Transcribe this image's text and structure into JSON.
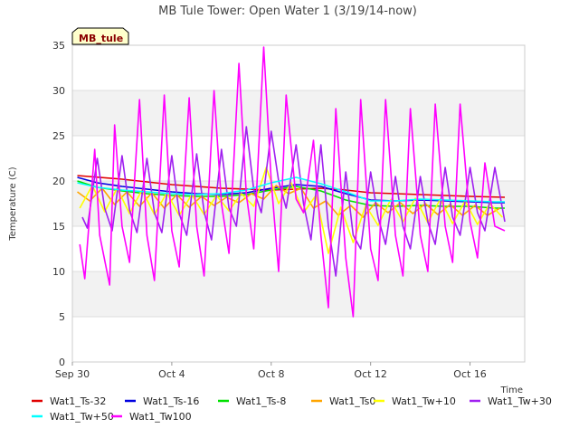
{
  "chart_data": {
    "type": "line",
    "title": "MB Tule Tower: Open Water 1 (3/19/14-now)",
    "xlabel": "Time",
    "ylabel": "Temperature (C)",
    "site_label": "MB_tule",
    "xlim": [
      0,
      18.2
    ],
    "ylim": [
      0,
      35
    ],
    "x_ticks": [
      {
        "value": 0,
        "label": "Sep 30"
      },
      {
        "value": 4,
        "label": "Oct 4"
      },
      {
        "value": 8,
        "label": "Oct 8"
      },
      {
        "value": 12,
        "label": "Oct 12"
      },
      {
        "value": 16,
        "label": "Oct 16"
      }
    ],
    "y_ticks": [
      0,
      5,
      10,
      15,
      20,
      25,
      30,
      35
    ],
    "grid": true,
    "legend_position": "bottom",
    "colors": {
      "site_label_bg": "#ffffcc",
      "site_label_text": "#8b0000",
      "band": "#f2f2f2",
      "grid": "#dddddd"
    },
    "series": [
      {
        "name": "Wat1_Ts-32",
        "color": "#e00000",
        "x": [
          0.2,
          2,
          4,
          6,
          8,
          10,
          11,
          12,
          14,
          16,
          17.4
        ],
        "y": [
          20.6,
          20.2,
          19.6,
          19.2,
          19.0,
          19.2,
          19.0,
          18.7,
          18.5,
          18.3,
          18.2
        ]
      },
      {
        "name": "Wat1_Ts-16",
        "color": "#0000e0",
        "x": [
          0.2,
          1,
          2,
          3,
          4,
          5,
          6,
          7,
          8,
          9,
          10,
          11,
          12,
          13,
          14,
          15,
          16,
          17,
          17.4
        ],
        "y": [
          20.4,
          19.8,
          19.4,
          19.1,
          18.8,
          18.6,
          18.5,
          18.7,
          19.2,
          19.6,
          19.4,
          18.6,
          17.9,
          17.8,
          17.9,
          17.8,
          17.7,
          17.6,
          17.6
        ]
      },
      {
        "name": "Wat1_Ts-8",
        "color": "#00e000",
        "x": [
          0.2,
          1,
          2,
          3,
          4,
          5,
          6,
          7,
          8,
          9,
          10,
          11,
          12,
          13,
          14,
          15,
          16,
          17,
          17.4
        ],
        "y": [
          20.0,
          19.3,
          18.9,
          18.6,
          18.4,
          18.3,
          18.3,
          18.5,
          19.0,
          19.4,
          18.9,
          17.9,
          17.3,
          17.2,
          17.3,
          17.2,
          17.2,
          17.0,
          17.0
        ]
      },
      {
        "name": "Wat1_Ts0",
        "color": "#ffa500",
        "x": [
          0.2,
          0.7,
          1.2,
          1.7,
          2.2,
          2.7,
          3.2,
          3.7,
          4.2,
          4.7,
          5.2,
          5.7,
          6.2,
          6.7,
          7.2,
          7.7,
          8.2,
          8.7,
          9.2,
          9.7,
          10.2,
          10.7,
          11.2,
          11.7,
          12.2,
          12.7,
          13.2,
          13.7,
          14.2,
          14.7,
          15.2,
          15.7,
          16.2,
          16.7,
          17.2
        ],
        "y": [
          18.8,
          17.8,
          19.2,
          17.4,
          18.8,
          17.2,
          18.7,
          17.0,
          18.5,
          17.1,
          18.3,
          17.3,
          18.2,
          17.6,
          18.6,
          18.0,
          19.5,
          18.6,
          19.2,
          17.0,
          17.8,
          16.2,
          17.3,
          16.0,
          17.6,
          16.5,
          17.6,
          16.4,
          17.5,
          16.3,
          17.4,
          16.2,
          17.3,
          16.2,
          17.0
        ]
      },
      {
        "name": "Wat1_Tw+10",
        "color": "#ffff00",
        "x": [
          0.3,
          0.8,
          1.3,
          1.8,
          2.3,
          2.8,
          3.3,
          3.8,
          4.3,
          4.8,
          5.3,
          5.8,
          6.3,
          6.8,
          7.3,
          7.8,
          8.3,
          8.8,
          9.3,
          9.8,
          10.3,
          10.8,
          11.3,
          11.8,
          12.3,
          12.8,
          13.3,
          13.8,
          14.3,
          14.8,
          15.3,
          15.8,
          16.3,
          16.8,
          17.3
        ],
        "y": [
          17.0,
          19.5,
          16.6,
          19.2,
          16.4,
          19.0,
          16.3,
          18.7,
          16.2,
          18.5,
          16.3,
          18.4,
          16.7,
          18.6,
          17.2,
          21.5,
          17.5,
          19.8,
          16.5,
          18.4,
          12.0,
          17.1,
          13.2,
          17.3,
          15.1,
          17.9,
          15.5,
          18.1,
          15.4,
          18.0,
          15.3,
          17.8,
          15.2,
          17.5,
          16.0
        ]
      },
      {
        "name": "Wat1_Tw+30",
        "color": "#a020f0",
        "x": [
          0.4,
          0.6,
          1.0,
          1.3,
          1.6,
          2.0,
          2.3,
          2.6,
          3.0,
          3.3,
          3.6,
          4.0,
          4.3,
          4.6,
          5.0,
          5.3,
          5.6,
          6.0,
          6.3,
          6.6,
          7.0,
          7.3,
          7.6,
          8.0,
          8.3,
          8.6,
          9.0,
          9.3,
          9.6,
          10.0,
          10.3,
          10.6,
          11.0,
          11.3,
          11.6,
          12.0,
          12.3,
          12.6,
          13.0,
          13.3,
          13.6,
          14.0,
          14.3,
          14.6,
          15.0,
          15.3,
          15.6,
          16.0,
          16.3,
          16.6,
          17.0,
          17.4
        ],
        "y": [
          16.0,
          14.8,
          22.5,
          17.0,
          14.5,
          22.8,
          16.8,
          14.3,
          22.5,
          16.5,
          14.3,
          22.8,
          16.4,
          14.0,
          23.0,
          16.6,
          13.5,
          23.5,
          17.0,
          15.0,
          26.0,
          19.0,
          16.5,
          25.5,
          20.0,
          17.0,
          24.0,
          17.5,
          13.5,
          24.0,
          15.0,
          9.5,
          21.0,
          14.0,
          12.5,
          21.0,
          16.0,
          13.0,
          20.5,
          15.0,
          12.5,
          20.5,
          15.5,
          13.0,
          21.5,
          16.0,
          14.0,
          21.5,
          16.5,
          14.5,
          21.5,
          15.5
        ]
      },
      {
        "name": "Wat1_Tw+50",
        "color": "#00ffff",
        "x": [
          0.2,
          1,
          2,
          3,
          4,
          5,
          6,
          7,
          8,
          9,
          10,
          11,
          12,
          13,
          14,
          15,
          16,
          17,
          17.4
        ],
        "y": [
          19.8,
          19.3,
          19.0,
          18.8,
          18.6,
          18.5,
          18.6,
          19.0,
          19.8,
          20.4,
          19.7,
          18.8,
          17.8,
          17.8,
          18.0,
          17.9,
          17.8,
          17.7,
          17.7
        ]
      },
      {
        "name": "Wat1_Tw100",
        "color": "#ff00ff",
        "x": [
          0.3,
          0.5,
          0.9,
          1.1,
          1.5,
          1.7,
          2.0,
          2.3,
          2.7,
          3.0,
          3.3,
          3.7,
          4.0,
          4.3,
          4.7,
          5.0,
          5.3,
          5.7,
          6.0,
          6.3,
          6.7,
          7.0,
          7.3,
          7.7,
          8.0,
          8.3,
          8.6,
          9.0,
          9.3,
          9.7,
          10.0,
          10.3,
          10.6,
          11.0,
          11.3,
          11.6,
          12.0,
          12.3,
          12.6,
          13.0,
          13.3,
          13.6,
          14.0,
          14.3,
          14.6,
          15.0,
          15.3,
          15.6,
          16.0,
          16.3,
          16.6,
          17.0,
          17.4
        ],
        "y": [
          13.0,
          9.2,
          23.5,
          14.0,
          8.5,
          26.2,
          15.0,
          11.0,
          29.0,
          14.0,
          9.0,
          29.5,
          14.5,
          10.5,
          29.2,
          15.0,
          9.5,
          30.0,
          17.5,
          12.0,
          33.0,
          18.5,
          12.5,
          34.8,
          20.0,
          10.0,
          29.5,
          18.0,
          16.5,
          24.5,
          14.0,
          6.0,
          28.0,
          11.5,
          5.0,
          29.0,
          12.5,
          9.0,
          29.0,
          14.0,
          9.5,
          28.0,
          14.0,
          10.0,
          28.5,
          15.0,
          11.0,
          28.5,
          15.5,
          11.5,
          22.0,
          15.0,
          14.5
        ]
      }
    ]
  }
}
